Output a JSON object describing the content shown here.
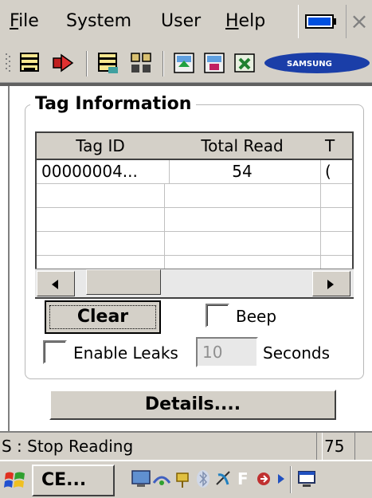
{
  "menubar": {
    "items": [
      {
        "label": "File",
        "underline": "F",
        "rest": "ile"
      },
      {
        "label": "System",
        "underline": "",
        "rest": "System"
      },
      {
        "label": "User",
        "underline": "",
        "rest": "User"
      },
      {
        "label": "Help",
        "underline": "H",
        "rest": "elp"
      }
    ],
    "close_glyph": "×",
    "battery_icon": "battery-icon"
  },
  "toolbar": {
    "icons": [
      "toolbar-grip-icon",
      "tag-list-icon",
      "start-read-icon",
      "tag-write-icon",
      "settings-icon",
      "export-icon",
      "import-icon",
      "excel-icon",
      "samsung-logo-icon"
    ],
    "samsung_text": "SAMSUNG"
  },
  "group": {
    "title": "Tag Information"
  },
  "grid": {
    "columns": [
      "Tag ID",
      "Total Read",
      "T"
    ],
    "rows": [
      [
        "00000004...",
        "54",
        "("
      ],
      [
        "",
        "",
        ""
      ],
      [
        "",
        "",
        ""
      ],
      [
        "",
        "",
        ""
      ],
      [
        "",
        "",
        ""
      ]
    ]
  },
  "controls": {
    "clear_label": "Clear",
    "beep_label": "Beep",
    "enable_leaks_label": "Enable Leaks",
    "seconds_value": "10",
    "seconds_label": "Seconds",
    "details_label": "Details...."
  },
  "status": {
    "text": "S :  Stop Reading",
    "count": "75"
  },
  "taskbar": {
    "ce_label": "CE...",
    "tray_letter": "F"
  },
  "colors": {
    "face": "#d4d0c8",
    "window_bg": "#ffffff",
    "battery_blue": "#0050e0"
  }
}
